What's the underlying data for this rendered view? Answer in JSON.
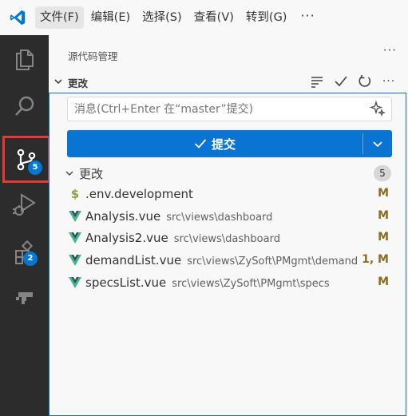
{
  "menu": {
    "items": [
      "文件(F)",
      "编辑(E)",
      "选择(S)",
      "查看(V)",
      "转到(G)"
    ],
    "more": "···"
  },
  "activity_bar": {
    "source_control_badge": "5",
    "extensions_badge": "2"
  },
  "sidebar": {
    "header": "源代码管理",
    "more": "···",
    "section_title": "更改",
    "commit_input_placeholder": "消息(Ctrl+Enter 在“master”提交)",
    "commit_button_label": "提交",
    "changes_group_label": "更改",
    "changes_count": "5",
    "files": [
      {
        "icon": "dollar-icon",
        "name": ".env.development",
        "path": "",
        "status": "M",
        "color": "#89a33e"
      },
      {
        "icon": "vue-icon",
        "name": "Analysis.vue",
        "path": "src\\views\\dashboard",
        "status": "M",
        "color": "#41b883"
      },
      {
        "icon": "vue-icon",
        "name": "Analysis2.vue",
        "path": "src\\views\\dashboard",
        "status": "M",
        "color": "#41b883"
      },
      {
        "icon": "vue-icon",
        "name": "demandList.vue",
        "path": "src\\views\\ZySoft\\PMgmt\\demand",
        "status": "1, M",
        "color": "#41b883"
      },
      {
        "icon": "vue-icon",
        "name": "specsList.vue",
        "path": "src\\views\\ZySoft\\PMgmt\\specs",
        "status": "M",
        "color": "#41b883"
      }
    ]
  },
  "colors": {
    "accent": "#0078d4",
    "selection_outline": "#e53935",
    "activity_bar": "#2c2c2c",
    "modified_status": "#8a6d1e"
  }
}
